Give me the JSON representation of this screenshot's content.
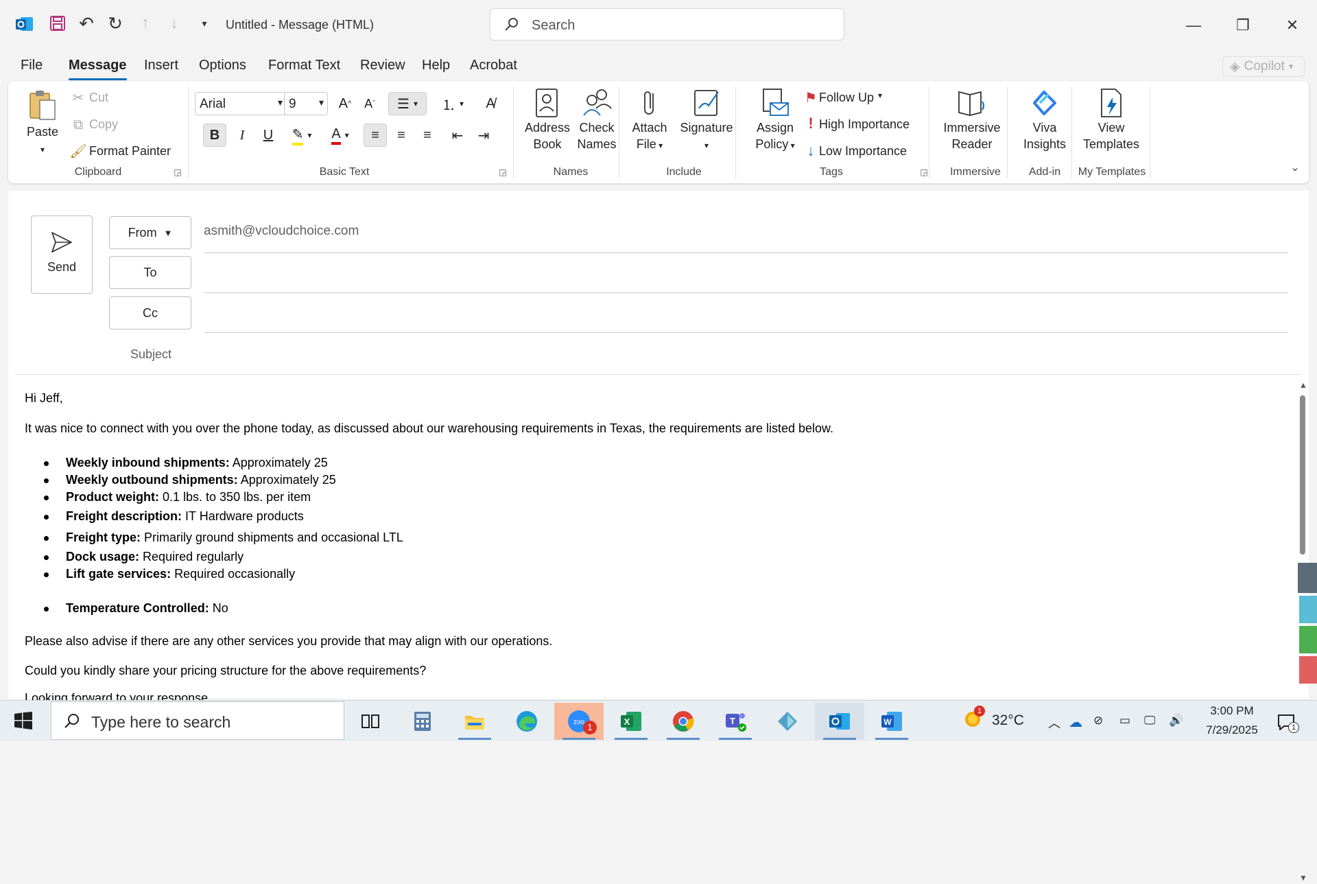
{
  "app": {
    "title": "Untitled  -  Message (HTML)",
    "search_placeholder": "Search",
    "copilot_label": "Copilot"
  },
  "menu": {
    "tabs": [
      "File",
      "Message",
      "Insert",
      "Options",
      "Format Text",
      "Review",
      "Help",
      "Acrobat"
    ],
    "active": "Message"
  },
  "ribbon": {
    "clipboard": {
      "paste": "Paste",
      "cut": "Cut",
      "copy": "Copy",
      "format_painter": "Format Painter",
      "group": "Clipboard"
    },
    "basic_text": {
      "font": "Arial",
      "size": "9",
      "group": "Basic Text"
    },
    "names": {
      "address_book_1": "Address",
      "address_book_2": "Book",
      "check_names_1": "Check",
      "check_names_2": "Names",
      "group": "Names"
    },
    "include": {
      "attach_1": "Attach",
      "attach_2": "File",
      "signature": "Signature",
      "group": "Include"
    },
    "tags": {
      "assign_1": "Assign",
      "assign_2": "Policy",
      "follow_up": "Follow Up",
      "high": "High Importance",
      "low": "Low Importance",
      "group": "Tags"
    },
    "immersive": {
      "reader_1": "Immersive",
      "reader_2": "Reader",
      "group": "Immersive"
    },
    "addin": {
      "viva_1": "Viva",
      "viva_2": "Insights",
      "group": "Add-in"
    },
    "templates": {
      "view_1": "View",
      "view_2": "Templates",
      "group": "My Templates"
    }
  },
  "compose": {
    "send_label": "Send",
    "from_label": "From",
    "from_value": "asmith@vcloudchoice.com",
    "to_label": "To",
    "cc_label": "Cc",
    "subject_label": "Subject"
  },
  "message": {
    "greeting": "Hi Jeff,",
    "intro": "It was nice to connect with you over the phone today, as discussed about our warehousing requirements in Texas, the requirements are listed below.",
    "items": [
      {
        "label": "Weekly inbound shipments:",
        "value": " Approximately 25"
      },
      {
        "label": "Weekly outbound shipments:",
        "value": " Approximately 25"
      },
      {
        "label": "Product weight:",
        "value": " 0.1 lbs. to 350 lbs. per item"
      },
      {
        "label": "Freight description:",
        "value": " IT Hardware products"
      },
      {
        "label": "Freight type:",
        "value": " Primarily ground shipments and occasional LTL"
      },
      {
        "label": "Dock usage:",
        "value": " Required regularly"
      },
      {
        "label": "Lift gate services:",
        "value": " Required occasionally"
      },
      {
        "label": "Temperature Controlled:",
        "value": " No"
      }
    ],
    "para2": "Please also advise if there are any other services you provide that may align with our operations.",
    "para3": "Could you kindly share your pricing structure for the above requirements?",
    "para4": "Looking forward to your response"
  },
  "taskbar": {
    "search_placeholder": "Type here to search",
    "weather": "32°C",
    "time": "3:00 PM",
    "date": "7/29/2025",
    "zoom_badge": "1",
    "weather_badge": "1",
    "notif_badge": "1"
  }
}
